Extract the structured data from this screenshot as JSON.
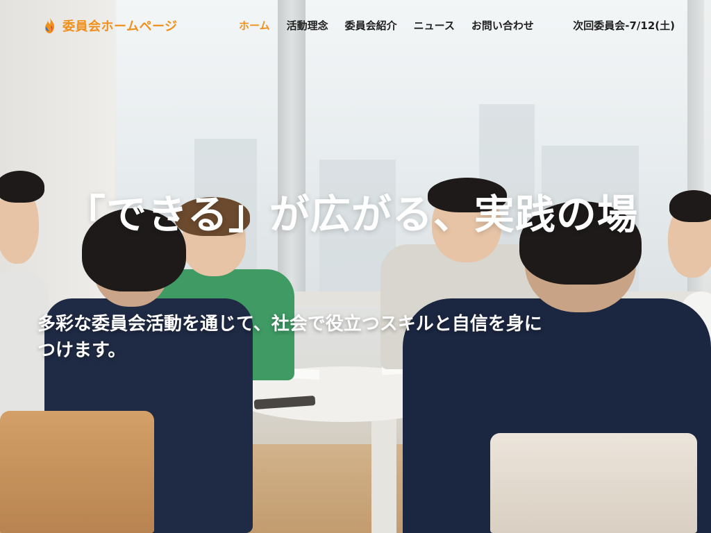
{
  "site": {
    "logo_text": "委員会ホームページ",
    "brand_color": "#f0901c",
    "logo_icon": "flame-logo-icon"
  },
  "nav": {
    "items": [
      {
        "label": "ホーム",
        "active": true
      },
      {
        "label": "活動理念",
        "active": false
      },
      {
        "label": "委員会紹介",
        "active": false
      },
      {
        "label": "ニュース",
        "active": false
      },
      {
        "label": "お問い合わせ",
        "active": false
      }
    ],
    "next_meeting": "次回委員会-7/12(土)"
  },
  "hero": {
    "headline": "「できる」が広がる、実践の場",
    "subtext_line1": "多彩な委員会活動を通じて、社会で役立つスキルと自信を身に",
    "subtext_line2": "つけます。"
  }
}
